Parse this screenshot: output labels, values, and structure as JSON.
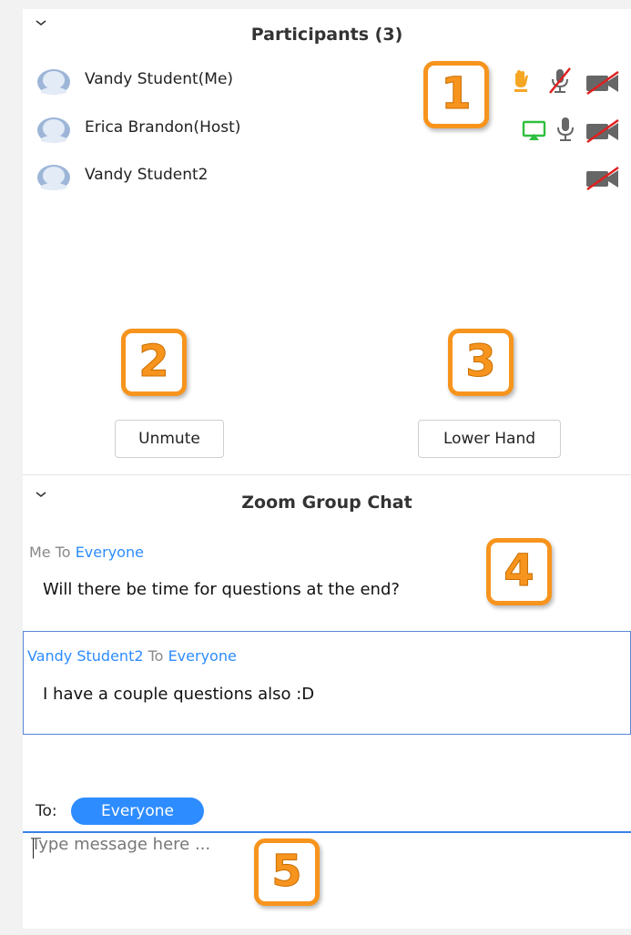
{
  "participants": {
    "title": "Participants (3)",
    "list": [
      {
        "name": "Vandy Student(Me)",
        "hand_raised": true,
        "mic": "muted",
        "video": "off"
      },
      {
        "name": "Erica Brandon(Host)",
        "sharing_screen": true,
        "mic": "on",
        "video": "off"
      },
      {
        "name": "Vandy Student2",
        "video": "off"
      }
    ],
    "buttons": {
      "unmute": "Unmute",
      "lower_hand": "Lower Hand"
    }
  },
  "chat": {
    "title": "Zoom Group Chat",
    "messages": [
      {
        "sender": "Me",
        "to_word": "To",
        "recipient": "Everyone",
        "text": "Will there be time for questions at the end?"
      },
      {
        "sender": "Vandy Student2",
        "to_word": "To",
        "recipient": "Everyone",
        "text": "I have a couple questions also :D"
      }
    ],
    "to_label": "To:",
    "recipient_selected": "Everyone",
    "input_placeholder": "Type message here ..."
  },
  "callouts": [
    "1",
    "2",
    "3",
    "4",
    "5"
  ],
  "colors": {
    "accent_blue": "#2d8cff",
    "callout_orange": "#f7941d",
    "hand_orange": "#f5a623",
    "share_green": "#2fbf3f",
    "muted_red": "#e02020"
  }
}
